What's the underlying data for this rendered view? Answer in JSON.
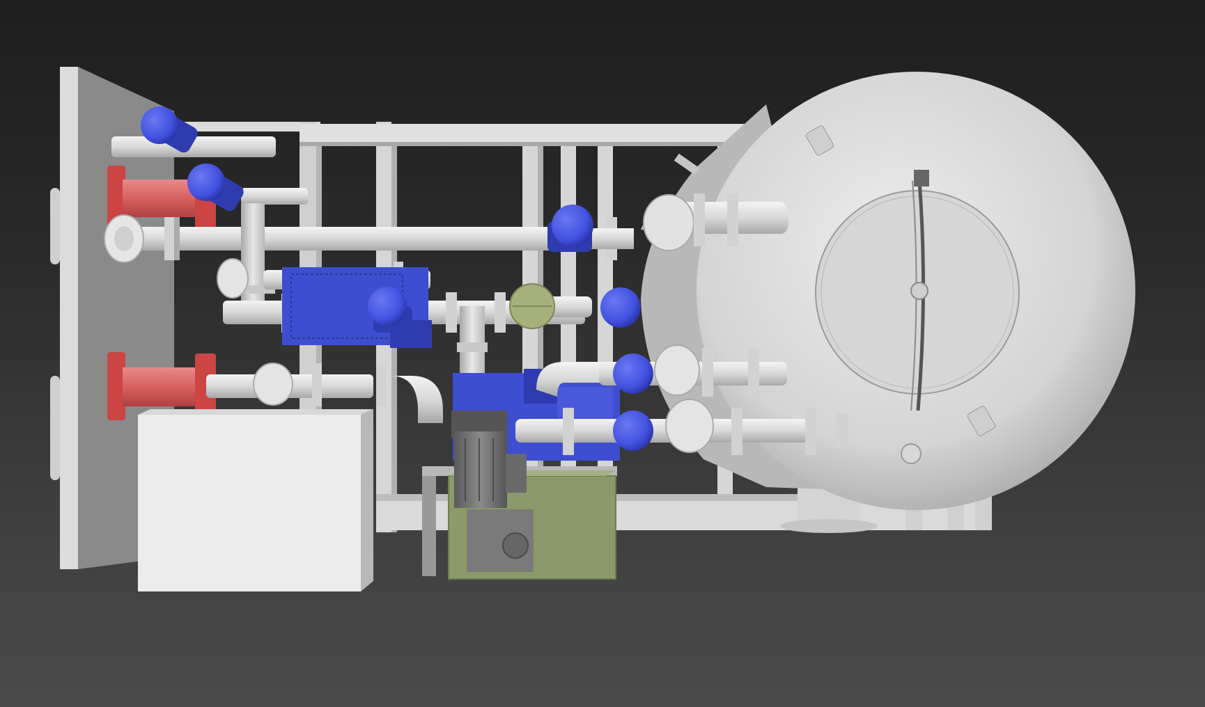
{
  "viewport": {
    "kind": "3D CAD viewport",
    "background": [
      "#1e1e1e",
      "#4a4a4a"
    ],
    "render_mode": "shaded",
    "text_labels": []
  },
  "model": {
    "name": "",
    "colors": {
      "structure": "#dcdcdc",
      "structure_shadow": "#9a9a9a",
      "valve_actuator": "#4a5ae0",
      "valve_actuator_dark": "#2f3cb0",
      "nozzle_flange": "#d85a5a",
      "pump_motor": "#6a6a6a",
      "sight_glass": "#a6b07a",
      "base_tray": "#8a9a6a"
    },
    "components": [
      {
        "id": "mounting-panel",
        "icon": "panel-icon"
      },
      {
        "id": "skid-frame",
        "icon": "frame-icon"
      },
      {
        "id": "pressure-vessel",
        "icon": "tank-icon"
      },
      {
        "id": "manway-hatch",
        "icon": "hatch-icon"
      },
      {
        "id": "inlet-nozzle-upper",
        "icon": "nozzle-icon"
      },
      {
        "id": "inlet-nozzle-lower",
        "icon": "nozzle-icon"
      },
      {
        "id": "actuated-valves",
        "icon": "valve-icon",
        "count": 7
      },
      {
        "id": "sight-glass",
        "icon": "sight-glass-icon"
      },
      {
        "id": "pump-motor",
        "icon": "motor-icon"
      },
      {
        "id": "base-tray",
        "icon": "tray-icon"
      },
      {
        "id": "control-box",
        "icon": "box-icon"
      }
    ]
  }
}
